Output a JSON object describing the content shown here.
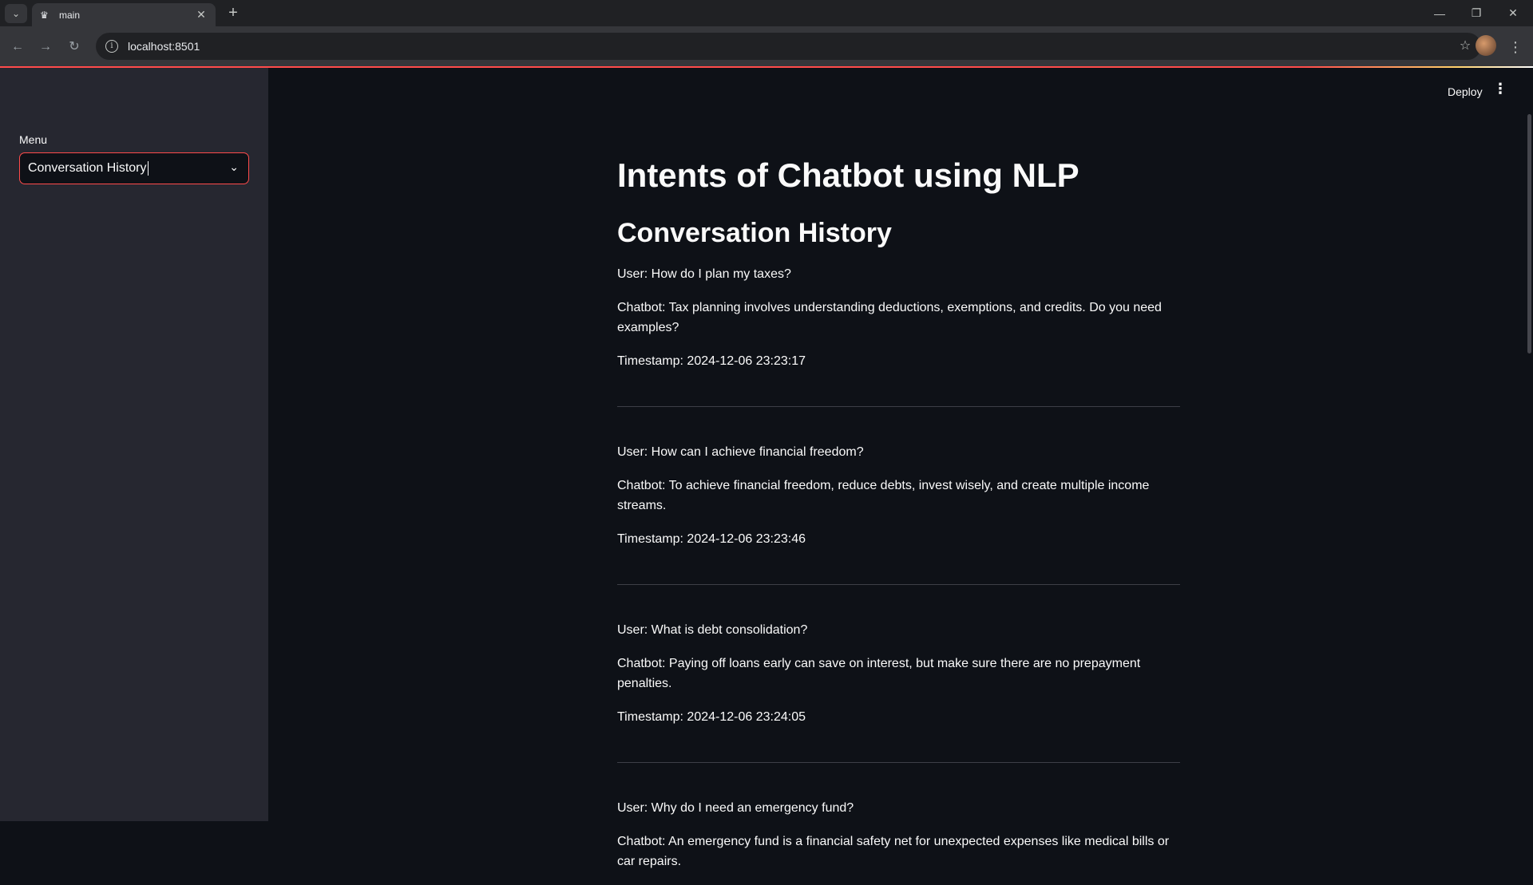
{
  "browser": {
    "tab_title": "main",
    "url": "localhost:8501"
  },
  "sidebar": {
    "menu_label": "Menu",
    "selected": "Conversation History"
  },
  "header": {
    "deploy_label": "Deploy"
  },
  "main": {
    "title": "Intents of Chatbot using NLP",
    "section_title": "Conversation History",
    "conversations": [
      {
        "user": "User: How do I plan my taxes?",
        "bot": "Chatbot: Tax planning involves understanding deductions, exemptions, and credits. Do you need examples?",
        "timestamp": "Timestamp: 2024-12-06 23:23:17"
      },
      {
        "user": "User: How can I achieve financial freedom?",
        "bot": "Chatbot: To achieve financial freedom, reduce debts, invest wisely, and create multiple income streams.",
        "timestamp": "Timestamp: 2024-12-06 23:23:46"
      },
      {
        "user": "User: What is debt consolidation?",
        "bot": "Chatbot: Paying off loans early can save on interest, but make sure there are no prepayment penalties.",
        "timestamp": "Timestamp: 2024-12-06 23:24:05"
      },
      {
        "user": "User: Why do I need an emergency fund?",
        "bot": "Chatbot: An emergency fund is a financial safety net for unexpected expenses like medical bills or car repairs."
      }
    ]
  }
}
